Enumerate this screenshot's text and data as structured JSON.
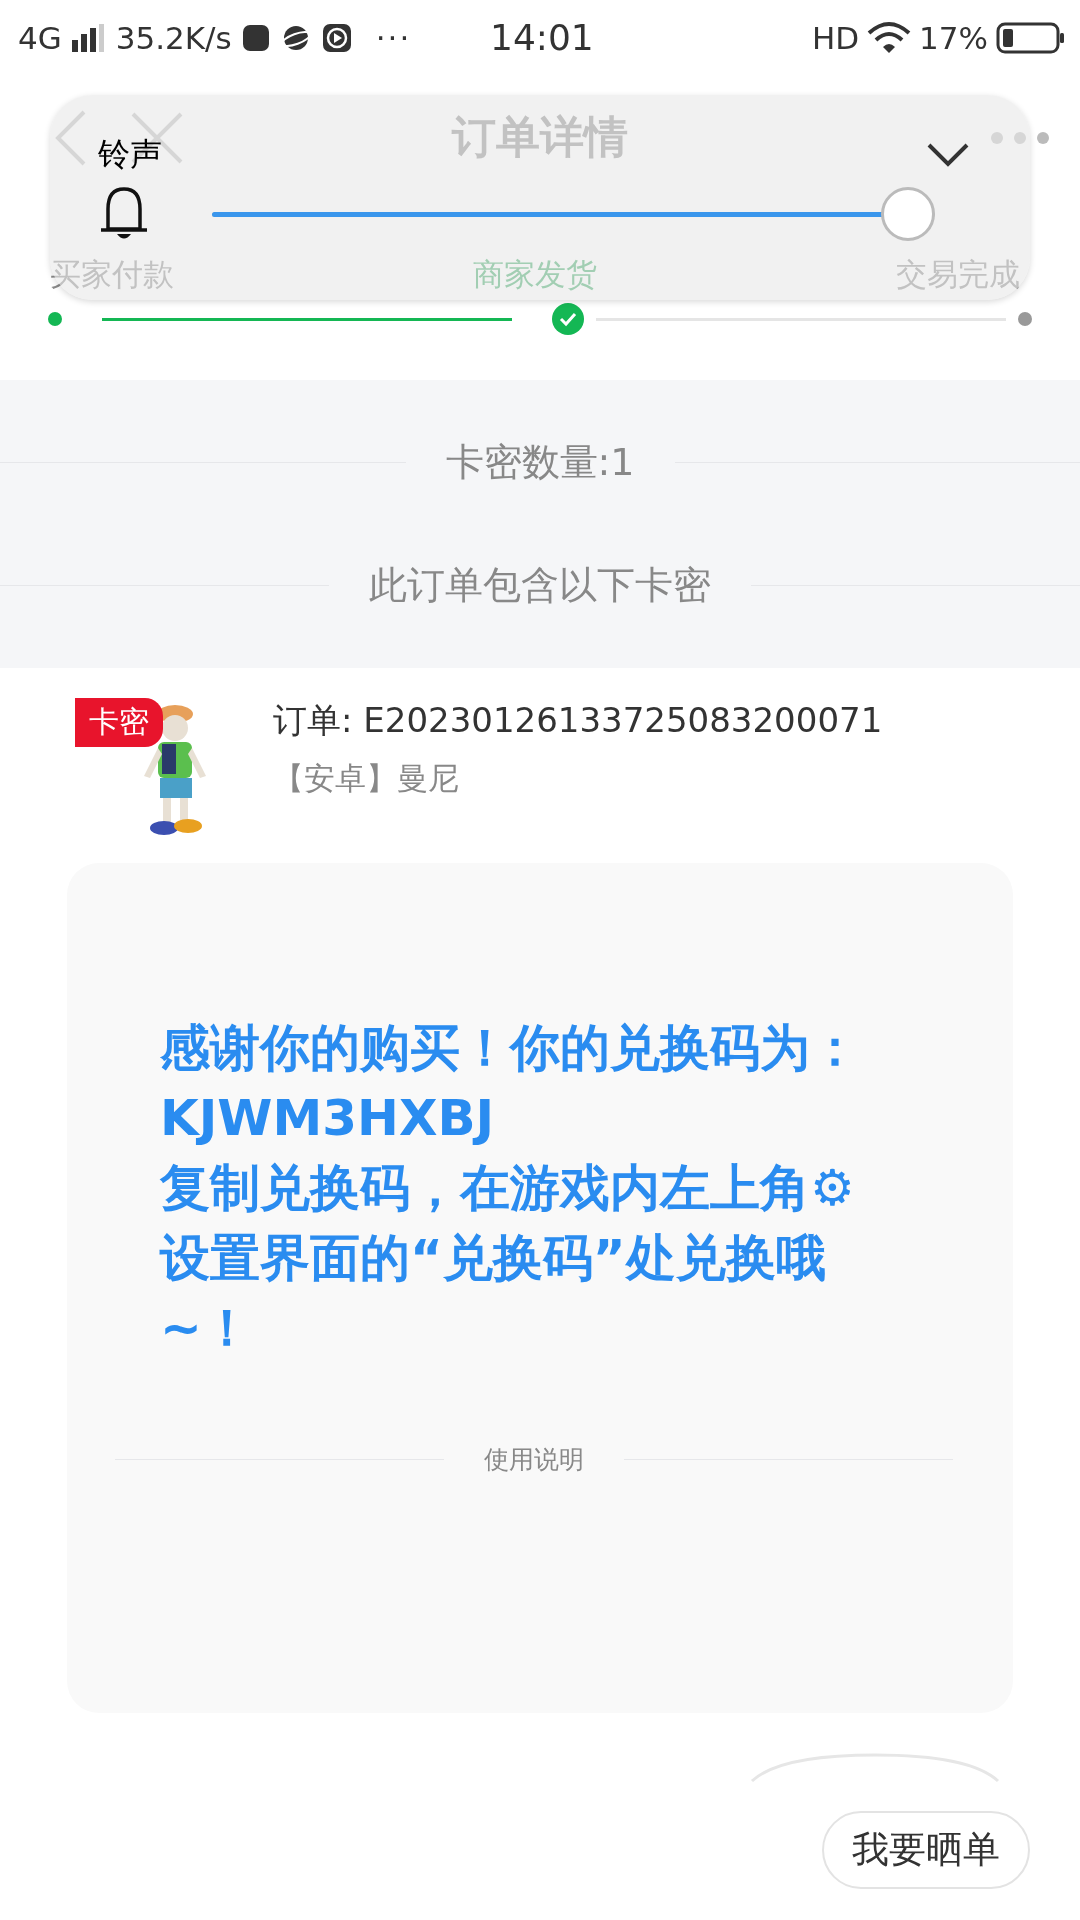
{
  "status_bar": {
    "network": "4G",
    "speed": "35.2K/s",
    "more": "···",
    "time": "14:01",
    "hd": "HD",
    "battery": "17%"
  },
  "header": {
    "title": "订单详情"
  },
  "steps": [
    {
      "label": "买家付款",
      "done": true,
      "current": false
    },
    {
      "label": "商家发货",
      "done": true,
      "current": true
    },
    {
      "label": "交易完成",
      "done": false,
      "current": false
    }
  ],
  "volume_panel": {
    "label": "铃声",
    "level": 1.0
  },
  "summary": {
    "count": "卡密数量:1",
    "note": "此订单包含以下卡密"
  },
  "order": {
    "badge": "卡密",
    "number": "订单: E20230126133725083200071",
    "product": "【安卓】曼尼"
  },
  "card": {
    "message": "感谢你的购买！你的兑换码为：KJWM3HXBJ\n复制兑换码，在游戏内左上角⚙\n设置界面的“兑换码”处兑换哦\n~！",
    "instructions": "使用说明"
  },
  "buttons": [
    "我要晒单"
  ]
}
